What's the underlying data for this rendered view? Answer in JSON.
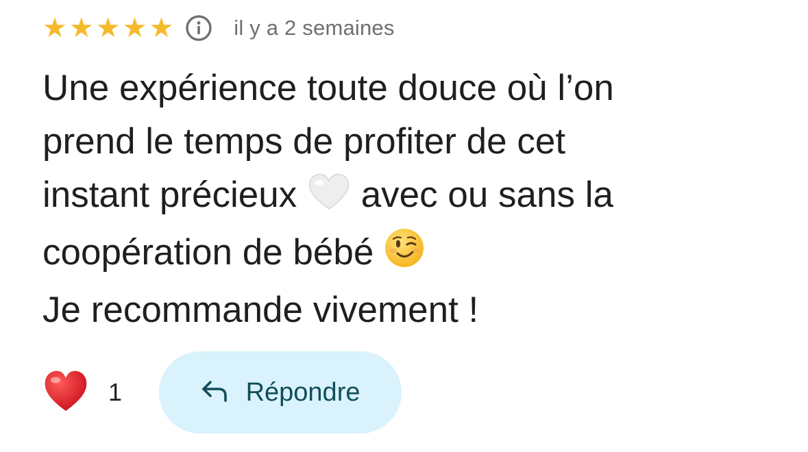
{
  "review": {
    "rating": 5,
    "rating_max": 5,
    "date": "il y a 2 semaines",
    "text_lines": [
      "Une expérience toute douce où l’on",
      "prend le temps de profiter de cet",
      "instant précieux",
      "avec ou sans la",
      "coopération de bébé",
      "Je recommande vivement !"
    ]
  },
  "icons": {
    "star": "star-icon",
    "info": "info-icon",
    "white_heart": "white-heart-emoji",
    "wink": "wink-emoji",
    "red_heart": "red-heart-emoji",
    "reply": "reply-arrow-icon"
  },
  "actions": {
    "like_count": "1",
    "reply_label": "Répondre"
  },
  "colors": {
    "star": "#f6b92a",
    "date_text": "#6f6f6f",
    "reply_bg": "#d9f2fb",
    "reply_text": "#114d5a"
  }
}
